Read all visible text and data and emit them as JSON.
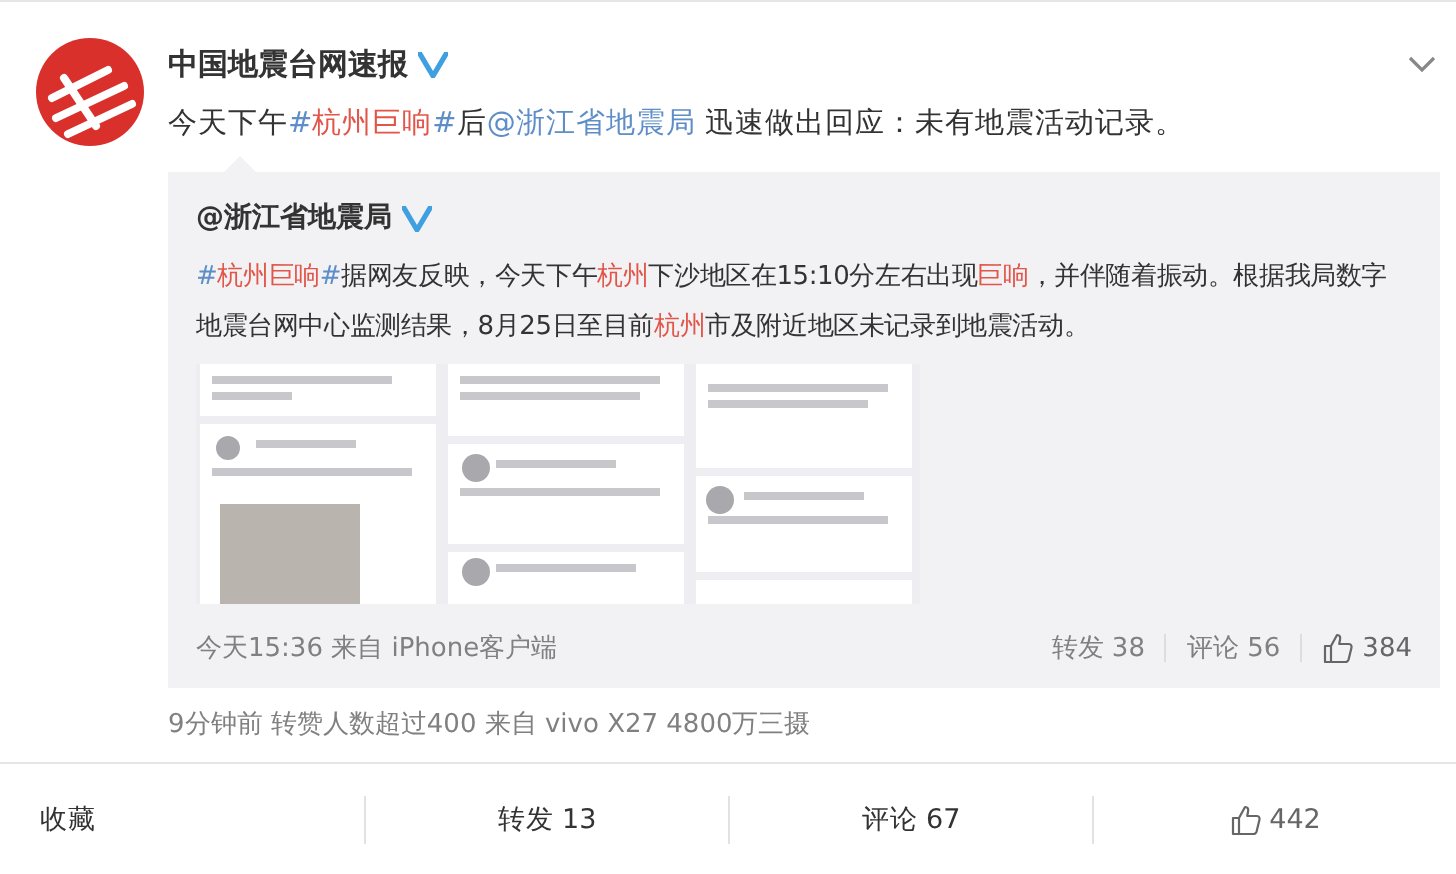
{
  "post": {
    "author": "中国地震台网速报",
    "verified": true,
    "text": [
      {
        "kind": "plain",
        "text": "今天下午"
      },
      {
        "kind": "link",
        "text": "#"
      },
      {
        "kind": "highlight",
        "text": "杭州巨响"
      },
      {
        "kind": "link",
        "text": "#"
      },
      {
        "kind": "plain",
        "text": "后"
      },
      {
        "kind": "link",
        "text": "@浙江省地震局"
      },
      {
        "kind": "plain",
        "text": " 迅速做出回应：未有地震活动记录。"
      }
    ],
    "quoted": {
      "author": "@浙江省地震局",
      "verified": true,
      "text": [
        {
          "kind": "link",
          "text": "#"
        },
        {
          "kind": "highlight",
          "text": "杭州巨响"
        },
        {
          "kind": "link",
          "text": "#"
        },
        {
          "kind": "plain",
          "text": "据网友反映，今天下午"
        },
        {
          "kind": "highlight",
          "text": "杭州"
        },
        {
          "kind": "plain",
          "text": "下沙地区在15:10分左右出现"
        },
        {
          "kind": "highlight",
          "text": "巨响"
        },
        {
          "kind": "plain",
          "text": "，并伴随着振动。根据我局数字地震台网中心监测结果，8月25日至目前"
        },
        {
          "kind": "highlight",
          "text": "杭州"
        },
        {
          "kind": "plain",
          "text": "市及附近地区未记录到地震活动。"
        }
      ],
      "time": "今天15:36 来自 iPhone客户端",
      "reposts": "转发 38",
      "comments": "评论 56",
      "likes": "384"
    },
    "meta": "9分钟前 转赞人数超过400  来自 vivo X27 4800万三摄"
  },
  "actions": {
    "favorite": "收藏",
    "reposts": "转发 13",
    "comments": "评论 67",
    "likes": "442"
  }
}
